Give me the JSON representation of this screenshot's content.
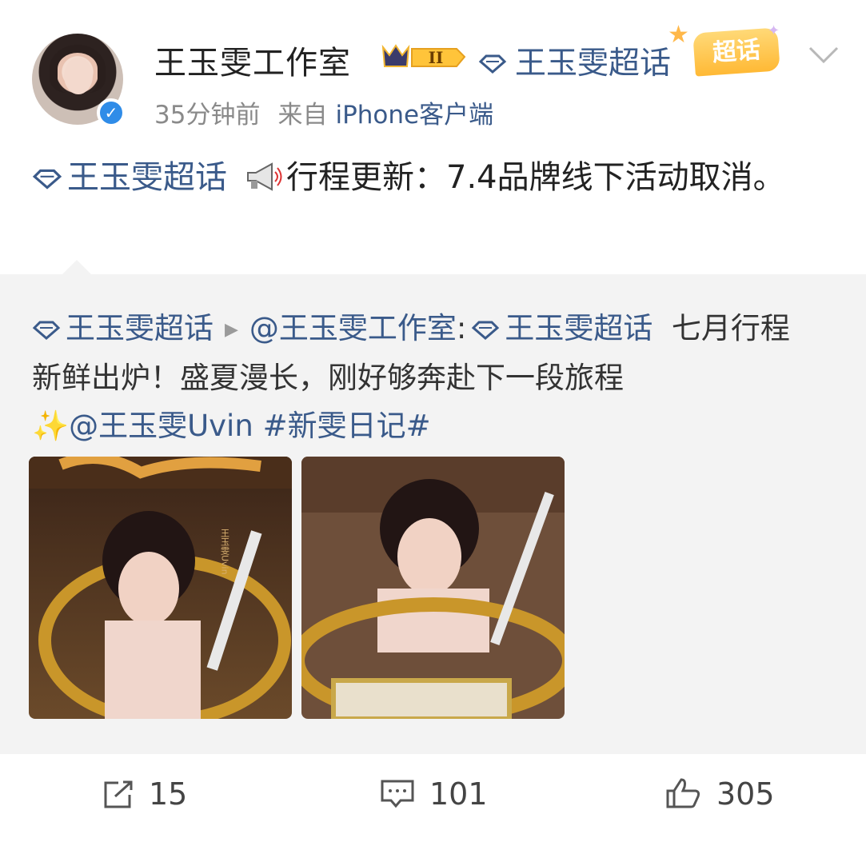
{
  "post": {
    "username": "王玉雯工作室",
    "badge_level": "II",
    "super_topic_link": "王玉雯超话",
    "super_topic_badge": "超话",
    "time": "35分钟前",
    "source_prefix": "来自",
    "source_client": "iPhone客户端",
    "text_link": "王玉雯超话",
    "text_body": "行程更新：7.4品牌线下活动取消。"
  },
  "repost": {
    "topic_link": "王玉雯超话",
    "mention": "@王玉雯工作室",
    "colon": ":",
    "topic_link_2": "王玉雯超话",
    "body": "七月行程新鲜出炉！盛夏漫长，刚好够奔赴下一段旅程",
    "sparkle": "✨",
    "mention_2": "@王玉雯Uvin",
    "hashtag": "#新雯日记#",
    "image1_caption": "王玉雯Uvin"
  },
  "actions": {
    "share_count": "15",
    "comment_count": "101",
    "like_count": "305"
  },
  "colors": {
    "link": "#3a5a8a",
    "repost_bg": "#f3f3f3",
    "verified": "#2f8ce8",
    "badge_gold": "#ffb935"
  },
  "icons": [
    "verified-icon",
    "crown-badge-icon",
    "diamond-icon",
    "chevron-down-icon",
    "megaphone-icon",
    "share-icon",
    "comment-icon",
    "like-icon"
  ]
}
